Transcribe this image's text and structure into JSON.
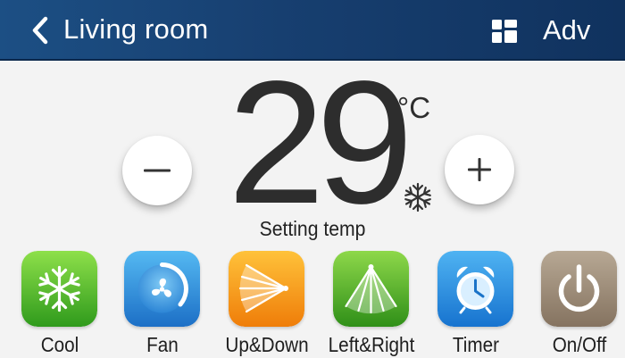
{
  "header": {
    "title": "Living room",
    "adv_label": "Adv",
    "back_icon": "chevron-left-icon",
    "grid_icon": "grid-icon"
  },
  "thermostat": {
    "temperature": "29",
    "unit": "°C",
    "caption": "Setting temp",
    "minus_symbol": "−",
    "plus_symbol": "+",
    "mode_icon": "snowflake-icon"
  },
  "modes": [
    {
      "label": "Cool",
      "icon": "snowflake-icon",
      "color": "#4fb82f"
    },
    {
      "label": "Fan",
      "icon": "fan-icon",
      "color": "#2a88d8"
    },
    {
      "label": "Up&Down",
      "icon": "vertical-swing-icon",
      "color": "#f3920f"
    },
    {
      "label": "Left&Right",
      "icon": "horizontal-swing-icon",
      "color": "#4ea628"
    },
    {
      "label": "Timer",
      "icon": "alarm-clock-icon",
      "color": "#2494e4"
    },
    {
      "label": "On/Off",
      "icon": "power-icon",
      "color": "#9b8a76"
    }
  ],
  "colors": {
    "header_start": "#1c4f84",
    "header_end": "#10325e",
    "background": "#f3f3f3"
  }
}
